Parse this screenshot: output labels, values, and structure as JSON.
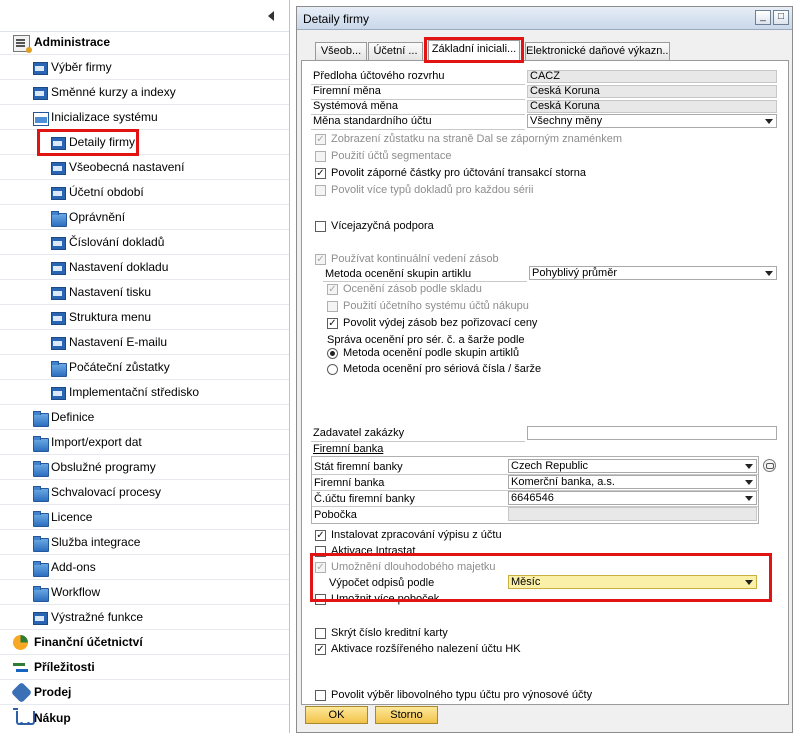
{
  "nav": {
    "sections": [
      {
        "label": "Administrace",
        "icon": "admin-icon"
      },
      {
        "label": "Finanční účetnictví",
        "icon": "finance-pie-icon"
      },
      {
        "label": "Příležitosti",
        "icon": "opportunities-icon"
      },
      {
        "label": "Prodej",
        "icon": "sales-icon"
      },
      {
        "label": "Nákup",
        "icon": "purchase-cart-icon"
      }
    ],
    "items": [
      "Výběr firmy",
      "Směnné kurzy a indexy",
      "Inicializace systému",
      "Detaily firmy",
      "Všeobecná nastavení",
      "Účetní období",
      "Oprávnění",
      "Číslování dokladů",
      "Nastavení dokladu",
      "Nastavení tisku",
      "Struktura menu",
      "Nastavení E-mailu",
      "Počáteční zůstatky",
      "Implementační středisko",
      "Definice",
      "Import/export dat",
      "Obslužné programy",
      "Schvalovací procesy",
      "Licence",
      "Služba integrace",
      "Add-ons",
      "Workflow",
      "Výstražné funkce"
    ]
  },
  "window": {
    "title": "Detaily firmy",
    "tabs": [
      "Všeob...",
      "Účetní ...",
      "Základní iniciali...",
      "Elektronické daňové výkazn..."
    ],
    "active_tab": "Základní iniciali..."
  },
  "form": {
    "predloha_label": "Předloha účtového rozvrhu",
    "predloha_value": "CACZ",
    "firemni_mena_label": "Firemní měna",
    "firemni_mena_value": "Česká Koruna",
    "systemova_mena_label": "Systémová měna",
    "systemova_mena_value": "Česká Koruna",
    "mena_std_label": "Měna standardního účtu",
    "mena_std_value": "Všechny měny",
    "cb_zobrazeni": "Zobrazení zůstatku na straně Dal se záporným znaménkem",
    "cb_segmentace": "Použití účtů segmentace",
    "cb_zaporne": "Povolit záporné částky pro účtování transakcí storna",
    "cb_vice_typu": "Povolit více typů dokladů pro každou sérii",
    "cb_vicejazycna": "Vícejazyčná podpora",
    "cb_kontinualni": "Používat kontinuální vedení zásob",
    "metoda_label": "Metoda ocenění skupin artiklu",
    "metoda_value": "Pohyblivý průměr",
    "cb_oceneni_sklad": "Ocenění zásob podle skladu",
    "cb_ucetni_system": "Použití účetního systému účtů nákupu",
    "cb_vydej": "Povolit výdej zásob bez pořizovací ceny",
    "sprava_label": "Správa ocenění pro sér. č. a šarže podle",
    "radio_skupin": "Metoda ocenění podle skupin artiklů",
    "radio_seriova": "Metoda ocenění pro sériová čísla / šarže",
    "zadavatel_label": "Zadavatel zakázky",
    "firemni_banka_label": "Firemní banka",
    "stat_banky_label": "Stát firemní banky",
    "stat_banky_value": "Czech Republic",
    "firemni_banka_field_label": "Firemní banka",
    "firemni_banka_value": "Komerční banka, a.s.",
    "cislo_uctu_label": "Č.účtu firemní banky",
    "cislo_uctu_value": "6646546",
    "pobocka_label": "Pobočka",
    "cb_instalovat": "Instalovat zpracování výpisu z účtu",
    "cb_intrastat": "Aktivace Intrastat",
    "cb_dlouhodobeho": "Umožnění dlouhodobého majetku",
    "vypocet_label": "Výpočet odpisů podle",
    "vypocet_value": "Měsíc",
    "cb_pobocek": "Umožnit více poboček",
    "cb_skryt": "Skrýt číslo kreditní karty",
    "cb_aktivace_hk": "Aktivace rozšířeného nalezení účtu HK",
    "cb_vynosove": "Povolit výběr libovolného typu účtu pro výnosové účty"
  },
  "buttons": {
    "ok": "OK",
    "storno": "Storno"
  },
  "colors": {
    "highlight_red": "#e21313",
    "button_gold": "#f2c24a",
    "field_yellow": "#fbf0a8"
  }
}
